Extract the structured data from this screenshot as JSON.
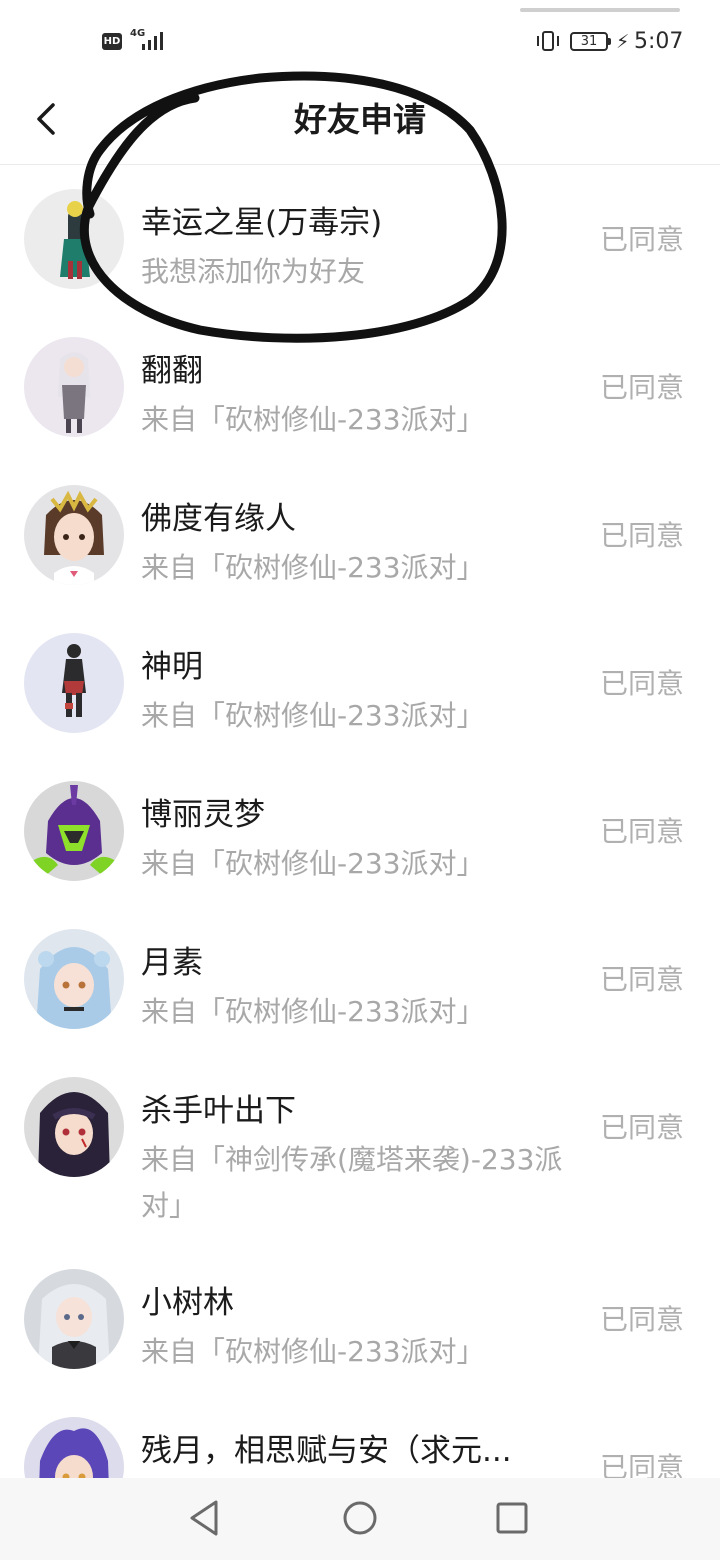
{
  "status_bar": {
    "hd_label": "HD",
    "network_label": "4G",
    "battery_level": "31",
    "time": "5:07"
  },
  "header": {
    "back_icon": "chevron-left-icon",
    "title": "好友申请"
  },
  "requests": [
    {
      "name": "幸运之星(万毒宗)",
      "subtitle": "我想添加你为好友",
      "status": "已同意",
      "avatar_bg": "#ececec"
    },
    {
      "name": "翻翻",
      "subtitle": "来自「砍树修仙-233派对」",
      "status": "已同意",
      "avatar_bg": "#ece7ef"
    },
    {
      "name": "佛度有缘人",
      "subtitle": "来自「砍树修仙-233派对」",
      "status": "已同意",
      "avatar_bg": "#e4e4e6"
    },
    {
      "name": "神明",
      "subtitle": "来自「砍树修仙-233派对」",
      "status": "已同意",
      "avatar_bg": "#e3e5f2"
    },
    {
      "name": "博丽灵梦",
      "subtitle": "来自「砍树修仙-233派对」",
      "status": "已同意",
      "avatar_bg": "#e0e0e0"
    },
    {
      "name": "月素",
      "subtitle": "来自「砍树修仙-233派对」",
      "status": "已同意",
      "avatar_bg": "#dfe6ee"
    },
    {
      "name": "杀手叶出下",
      "subtitle": "来自「神剑传承(魔塔来袭)-233派对」",
      "status": "已同意",
      "avatar_bg": "#dcdcdc"
    },
    {
      "name": "小树林",
      "subtitle": "来自「砍树修仙-233派对」",
      "status": "已同意",
      "avatar_bg": "#d6dadf"
    },
    {
      "name": "残月，相思赋与安（求元...",
      "subtitle": "",
      "status": "已同意",
      "avatar_bg": "#dcdcec"
    }
  ],
  "nav": {
    "back_icon": "triangle-back-icon",
    "home_icon": "circle-home-icon",
    "recents_icon": "square-recents-icon"
  }
}
